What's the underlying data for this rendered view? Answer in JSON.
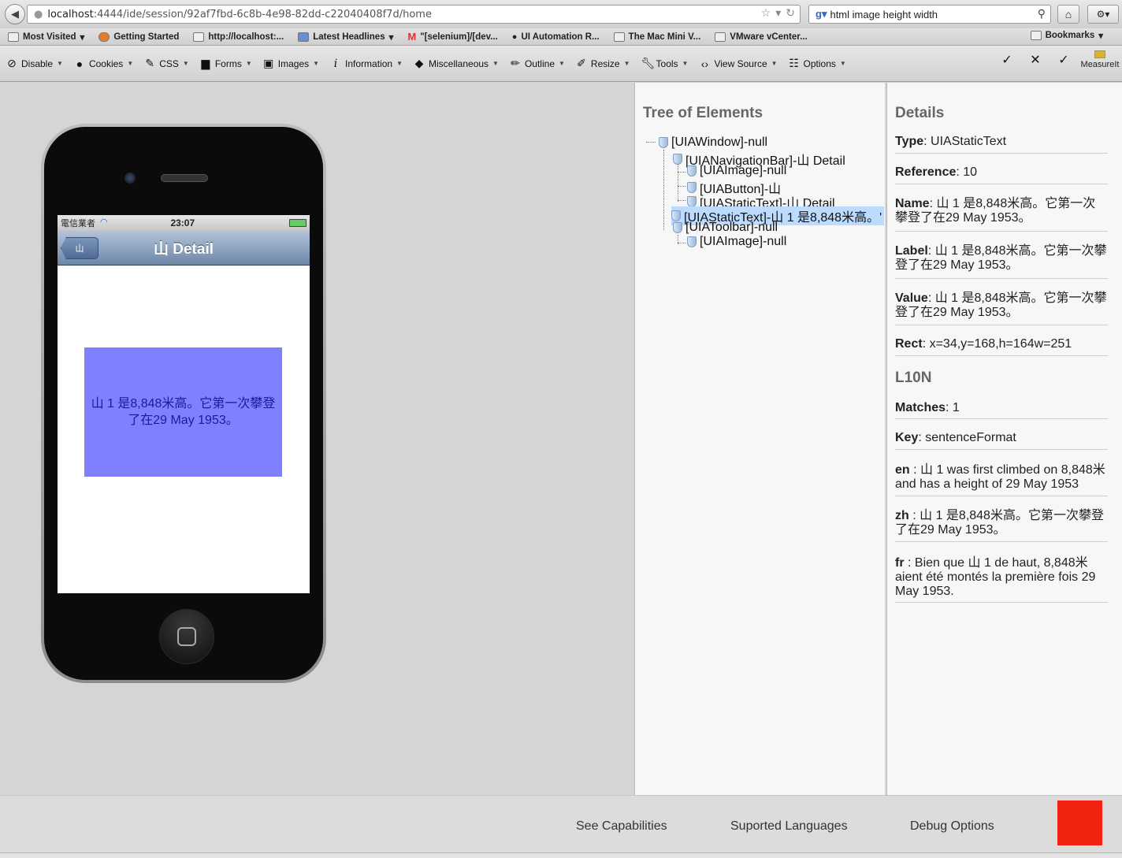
{
  "browser": {
    "url_host": "localhost",
    "url_path": ":4444/ide/session/92af7fbd-6c8b-4e98-82dd-c22040408f7d/home",
    "search_value": "html image height width",
    "bookmarks": [
      "Most Visited",
      "Getting Started",
      "http://localhost:...",
      "Latest Headlines",
      "\"[selenium]/[dev...",
      "UI Automation R...",
      "The Mac Mini V...",
      "VMware vCenter..."
    ],
    "bookmarks_menu": "Bookmarks"
  },
  "webdev_toolbar": {
    "items": [
      "Disable",
      "Cookies",
      "CSS",
      "Forms",
      "Images",
      "Information",
      "Miscellaneous",
      "Outline",
      "Resize",
      "Tools",
      "View Source",
      "Options"
    ],
    "measureit": "MeasureIt"
  },
  "iphone": {
    "carrier": "電信業者",
    "time": "23:07",
    "back_label": "山",
    "nav_title": "山 Detail",
    "static_text": "山 1 是8,848米高。它第一次攀登了在29 May 1953。"
  },
  "tree": {
    "title": "Tree of Elements",
    "nodes": [
      "[UIAWindow]-null",
      "[UIANavigationBar]-山 Detail",
      "[UIAImage]-null",
      "[UIAButton]-山",
      "[UIAStaticText]-山 Detail",
      "[UIAStaticText]-山 1 是8,848米高。'",
      "[UIAToolbar]-null",
      "[UIAImage]-null"
    ]
  },
  "details": {
    "title": "Details",
    "type_label": "Type",
    "type_value": "UIAStaticText",
    "reference_label": "Reference",
    "reference_value": "10",
    "name_label": "Name",
    "name_value": "山 1 是8,848米高。它第一次攀登了在29 May 1953。",
    "label_label": "Label",
    "label_value": "山 1 是8,848米高。它第一次攀登了在29 May 1953。",
    "value_label": "Value",
    "value_value": "山 1 是8,848米高。它第一次攀登了在29 May 1953。",
    "rect_label": "Rect",
    "rect_value": "x=34,y=168,h=164w=251",
    "l10n_title": "L10N",
    "matches_label": "Matches",
    "matches_value": "1",
    "key_label": "Key",
    "key_value": "sentenceFormat",
    "en_label": "en",
    "en_value": "山 1 was first climbed on 8,848米 and has a height of 29 May 1953",
    "zh_label": "zh",
    "zh_value": "山 1 是8,848米高。它第一次攀登了在29 May 1953。",
    "fr_label": "fr",
    "fr_value": "Bien que 山 1 de haut, 8,848米 aient été montés la première fois 29 May 1953."
  },
  "footer": {
    "capabilities": "See Capabilities",
    "languages": "Suported Languages",
    "debug": "Debug Options"
  },
  "colors": {
    "static_text_bg": "#8080ff",
    "selected_node": "#bcdcff",
    "red_square": "#f32312"
  }
}
